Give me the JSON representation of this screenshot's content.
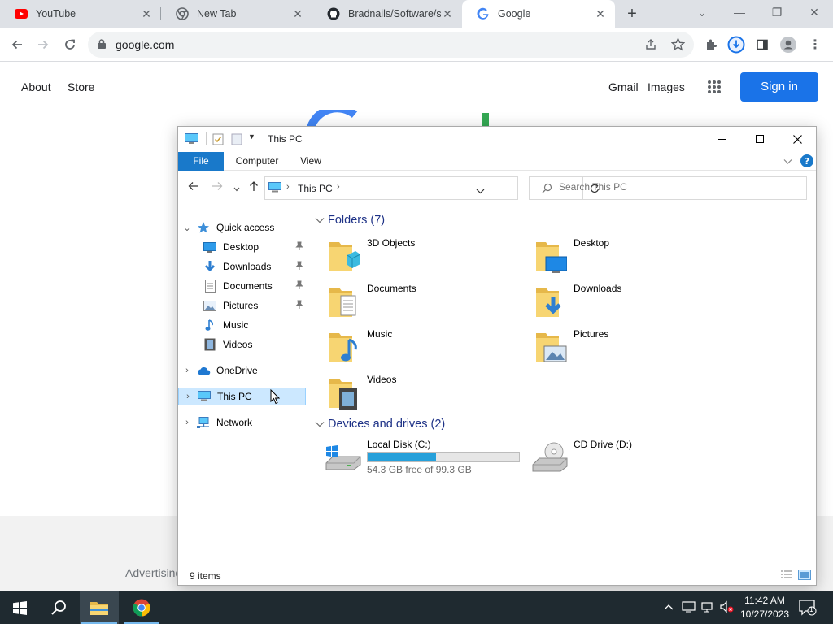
{
  "browser": {
    "tabs": [
      {
        "title": "YouTube",
        "icon": "youtube-icon"
      },
      {
        "title": "New Tab",
        "icon": "chrome-icon"
      },
      {
        "title": "Bradnails/Software/sof",
        "icon": "github-icon"
      },
      {
        "title": "Google",
        "icon": "google-icon",
        "active": true
      }
    ],
    "url": "google.com"
  },
  "google": {
    "links": {
      "about": "About",
      "store": "Store",
      "gmail": "Gmail",
      "images": "Images"
    },
    "sign_in": "Sign in",
    "footer_advertising": "Advertising"
  },
  "explorer": {
    "title": "This PC",
    "ribbon_tabs": [
      "File",
      "Computer",
      "View"
    ],
    "address": "This PC",
    "search_placeholder": "Search This PC",
    "nav": [
      {
        "label": "Quick access",
        "icon": "star-icon",
        "expanded": true
      },
      {
        "label": "Desktop",
        "icon": "desktop-icon",
        "pinned": true
      },
      {
        "label": "Downloads",
        "icon": "download-arrow-icon",
        "pinned": true
      },
      {
        "label": "Documents",
        "icon": "document-icon",
        "pinned": true
      },
      {
        "label": "Pictures",
        "icon": "pictures-icon",
        "pinned": true
      },
      {
        "label": "Music",
        "icon": "music-note-icon"
      },
      {
        "label": "Videos",
        "icon": "film-icon"
      },
      {
        "label": "OneDrive",
        "icon": "cloud-icon"
      },
      {
        "label": "This PC",
        "icon": "computer-icon",
        "selected": true
      },
      {
        "label": "Network",
        "icon": "network-icon"
      }
    ],
    "folders_header": "Folders (7)",
    "folders": [
      "3D Objects",
      "Desktop",
      "Documents",
      "Downloads",
      "Music",
      "Pictures",
      "Videos"
    ],
    "drives_header": "Devices and drives (2)",
    "drives": [
      {
        "name": "Local Disk (C:)",
        "free": "54.3 GB free of 99.3 GB",
        "used_fraction": 0.453
      },
      {
        "name": "CD Drive (D:)"
      }
    ],
    "status": "9 items"
  },
  "taskbar": {
    "time": "11:42 AM",
    "date": "10/27/2023",
    "notification_count": "1"
  },
  "colors": {
    "accent": "#1979ca",
    "google_blue": "#1a73e8",
    "taskbar": "#1f2a30",
    "drive_bar": "#26a0da"
  }
}
